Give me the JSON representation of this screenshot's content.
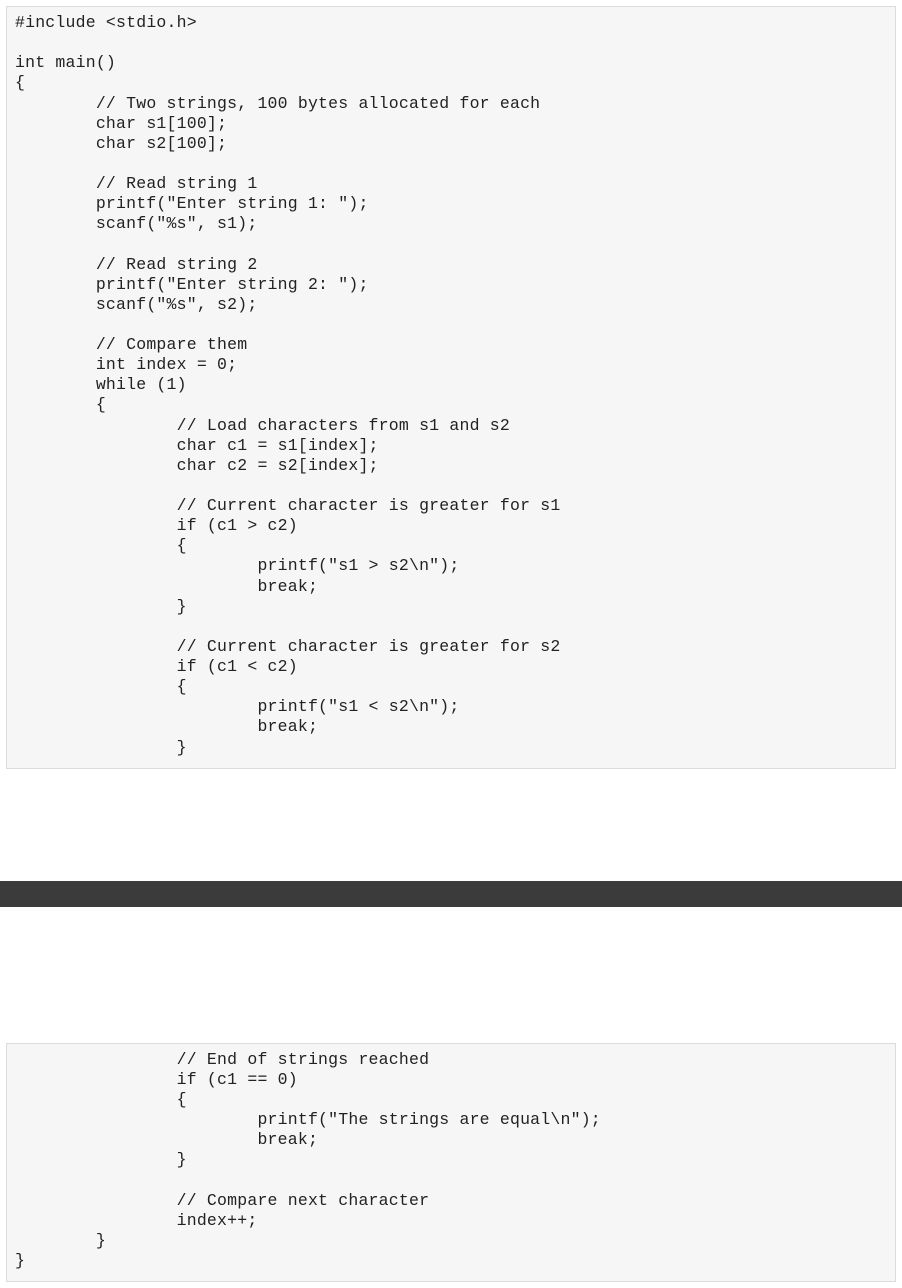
{
  "code_block_1": "#include <stdio.h>\n\nint main()\n{\n        // Two strings, 100 bytes allocated for each\n        char s1[100];\n        char s2[100];\n\n        // Read string 1\n        printf(\"Enter string 1: \");\n        scanf(\"%s\", s1);\n\n        // Read string 2\n        printf(\"Enter string 2: \");\n        scanf(\"%s\", s2);\n\n        // Compare them\n        int index = 0;\n        while (1)\n        {\n                // Load characters from s1 and s2\n                char c1 = s1[index];\n                char c2 = s2[index];\n\n                // Current character is greater for s1\n                if (c1 > c2)\n                {\n                        printf(\"s1 > s2\\n\");\n                        break;\n                }\n\n                // Current character is greater for s2\n                if (c1 < c2)\n                {\n                        printf(\"s1 < s2\\n\");\n                        break;\n                }",
  "code_block_2": "                // End of strings reached\n                if (c1 == 0)\n                {\n                        printf(\"The strings are equal\\n\");\n                        break;\n                }\n\n                // Compare next character\n                index++;\n        }\n}"
}
